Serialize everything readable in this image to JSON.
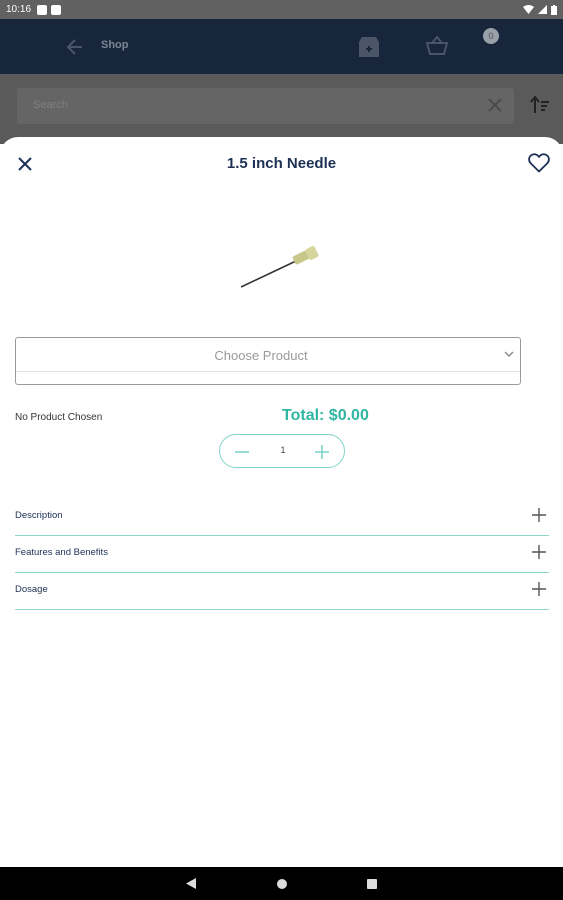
{
  "status_bar": {
    "time": "10:16"
  },
  "app_bar": {
    "title": "Shop",
    "cart_count": "0"
  },
  "search": {
    "placeholder": "Search"
  },
  "sheet": {
    "title": "1.5 inch Needle",
    "product_select": {
      "placeholder": "Choose Product"
    },
    "selection_status": "No Product Chosen",
    "total": "Total: $0.00",
    "quantity": "1",
    "accordion": [
      {
        "label": "Description"
      },
      {
        "label": "Features and Benefits"
      },
      {
        "label": "Dosage"
      }
    ]
  },
  "colors": {
    "accent": "#2fb5a2",
    "navy": "#1d3056",
    "app_bar": "#17263a"
  },
  "icons": [
    "close-icon",
    "heart-icon",
    "chevron-down-icon",
    "minus-icon",
    "plus-icon",
    "back-arrow-icon",
    "store-icon",
    "basket-icon",
    "sort-icon",
    "clear-icon"
  ]
}
